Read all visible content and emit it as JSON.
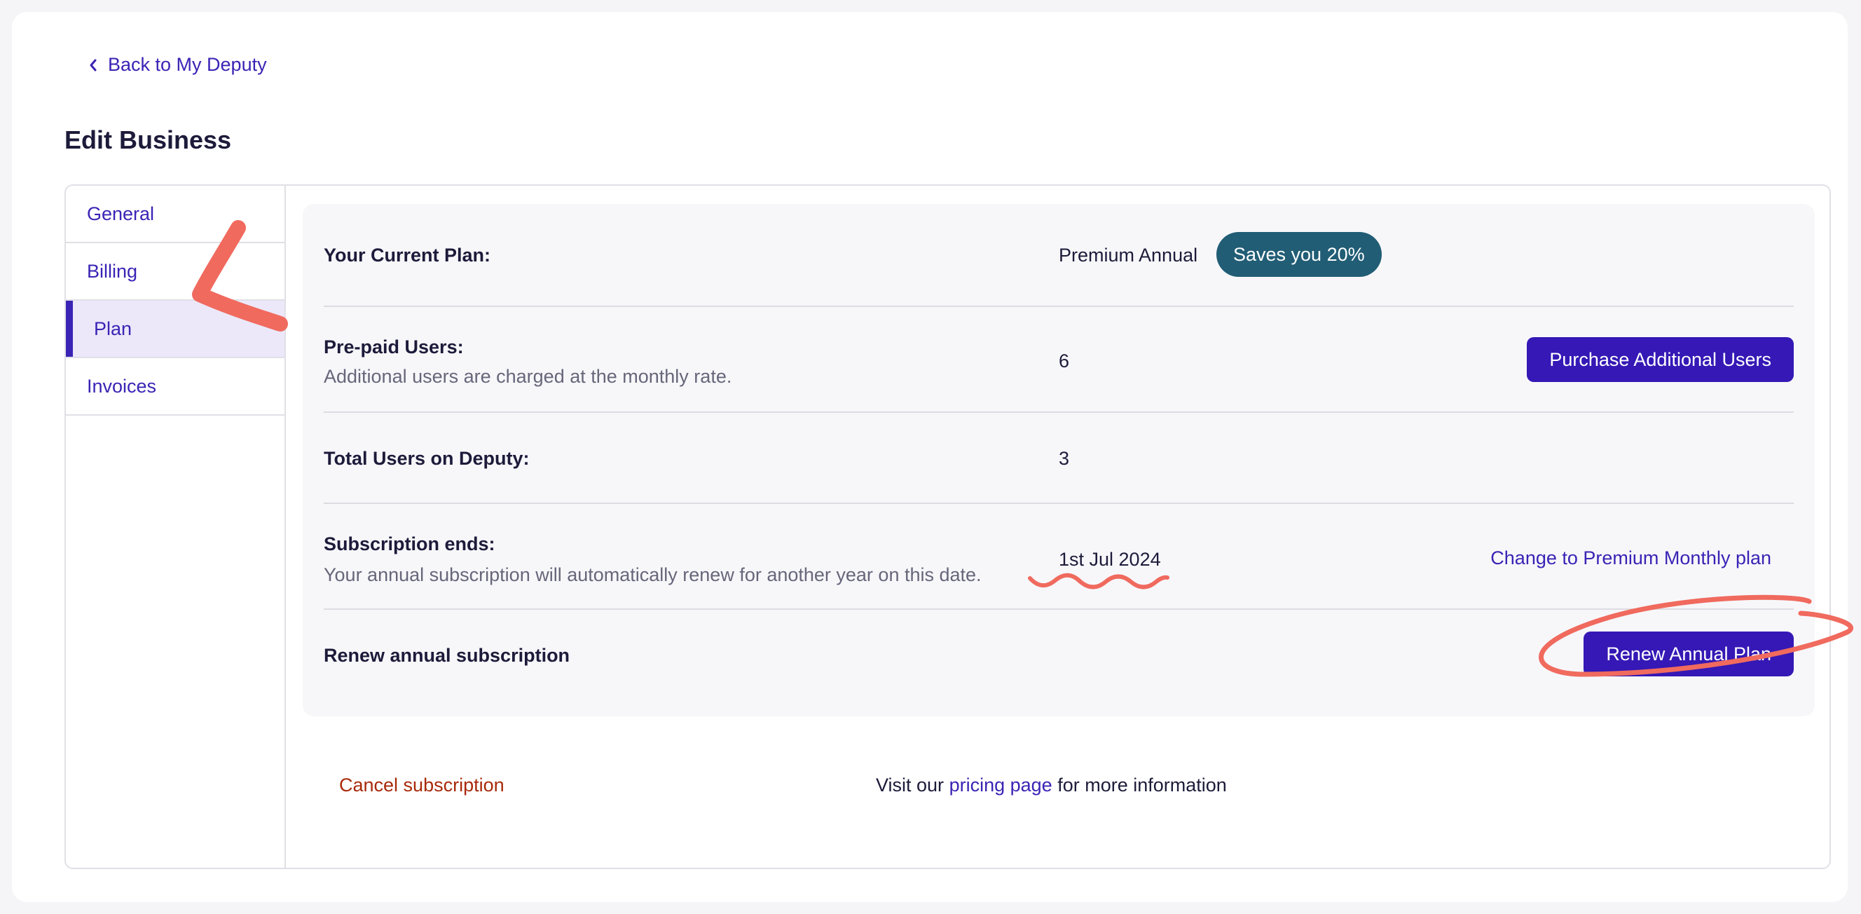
{
  "back_link": {
    "label": "Back to My Deputy"
  },
  "page": {
    "title": "Edit Business"
  },
  "sidebar": {
    "items": [
      {
        "label": "General"
      },
      {
        "label": "Billing"
      },
      {
        "label": "Plan",
        "active": true
      },
      {
        "label": "Invoices"
      }
    ]
  },
  "plan": {
    "current": {
      "label": "Your Current Plan:",
      "value": "Premium Annual",
      "badge": "Saves you 20%"
    },
    "prepaid": {
      "label": "Pre-paid Users:",
      "sub": "Additional users are charged at the monthly rate.",
      "value": "6",
      "button": "Purchase Additional Users"
    },
    "total": {
      "label": "Total Users on Deputy:",
      "value": "3"
    },
    "subscription": {
      "label": "Subscription ends:",
      "sub": "Your annual subscription will automatically renew for another year on this date.",
      "value": "1st Jul 2024",
      "link": "Change to Premium Monthly plan"
    },
    "renew": {
      "label": "Renew annual subscription",
      "button": "Renew Annual Plan"
    }
  },
  "footer": {
    "cancel": "Cancel subscription",
    "info_prefix": "Visit our",
    "info_link": "pricing page",
    "info_suffix": "for more information"
  },
  "colors": {
    "accent": "#3518b5",
    "badge": "#215d75",
    "danger": "#a82a0a",
    "annotation": "#f06a5e"
  }
}
